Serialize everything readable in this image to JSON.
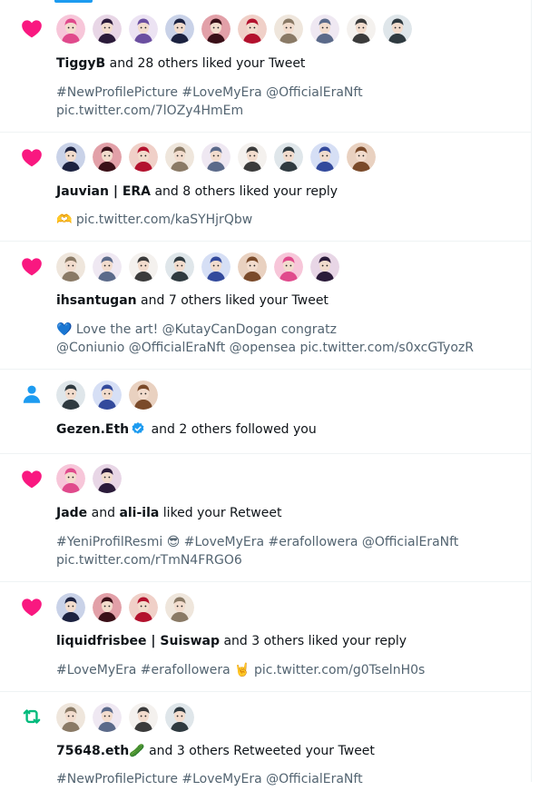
{
  "colors": {
    "like": "#f91880",
    "retweet": "#00ba7c",
    "follow": "#1d9bf0",
    "secondary_text": "#536471"
  },
  "notifications": [
    {
      "type": "like",
      "icon": "heart-icon",
      "avatar_count": 10,
      "user1": "TiggyB",
      "rest": " and 28 others liked your Tweet",
      "body": "#NewProfilePicture #LoveMyEra @OfficialEraNft\npic.twitter.com/7lOZy4HmEm"
    },
    {
      "type": "like",
      "icon": "heart-icon",
      "avatar_count": 9,
      "user1": "Jauvian | ERA",
      "rest": " and 8 others liked your reply",
      "body": "🫶 pic.twitter.com/kaSYHjrQbw"
    },
    {
      "type": "like",
      "icon": "heart-icon",
      "avatar_count": 8,
      "user1": "ihsantugan",
      "rest": " and 7 others liked your Tweet",
      "body": "💙 Love the art! @KutayCanDogan  congratz\n@Coniunio @OfficialEraNft  @opensea pic.twitter.com/s0xcGTyozR"
    },
    {
      "type": "follow",
      "icon": "person-icon",
      "avatar_count": 3,
      "user1": "Gezen.Eth",
      "verified": true,
      "rest": " and 2 others followed you",
      "body": ""
    },
    {
      "type": "like",
      "icon": "heart-icon",
      "avatar_count": 2,
      "user1": "Jade",
      "mid": " and ",
      "user2": "ali-ila",
      "rest": " liked your Retweet",
      "body": "#YeniProfilResmi 😎  #LoveMyEra #erafollowera  @OfficialEraNft\npic.twitter.com/rTmN4FRGO6"
    },
    {
      "type": "like",
      "icon": "heart-icon",
      "avatar_count": 4,
      "user1": "liquidfrisbee | Suiswap",
      "rest": " and 3 others liked your reply",
      "body": "#LoveMyEra #erafollowera 🤘 pic.twitter.com/g0TselnH0s"
    },
    {
      "type": "retweet",
      "icon": "retweet-icon",
      "avatar_count": 4,
      "user1": "75648.eth🥒",
      "rest": " and 3 others Retweeted your Tweet",
      "body": "#NewProfilePicture #LoveMyEra @OfficialEraNft"
    }
  ]
}
